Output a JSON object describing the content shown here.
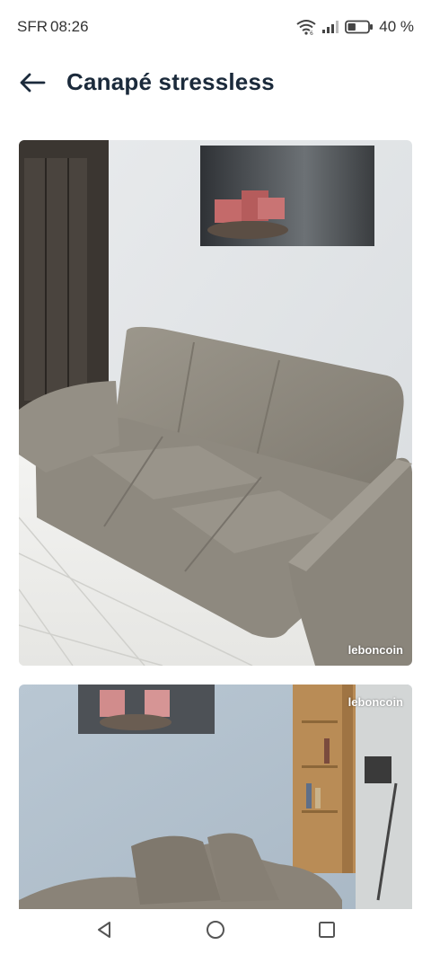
{
  "status_bar": {
    "carrier": "SFR",
    "time": "08:26",
    "battery_percent": "40 %",
    "battery_level": 0.4,
    "icons": [
      "wifi-icon",
      "signal-icon",
      "battery-icon"
    ]
  },
  "header": {
    "back_icon": "arrow-left-icon",
    "title": "Canapé stressless"
  },
  "photos": [
    {
      "watermark": "leboncoin"
    },
    {
      "watermark": "leboncoin"
    }
  ],
  "nav_bar": {
    "icons": [
      "back-triangle-icon",
      "home-circle-icon",
      "recents-square-icon"
    ]
  },
  "colors": {
    "title": "#1b2a3b",
    "sofa": "#8f8a80",
    "wall": "#e6e8ea"
  }
}
